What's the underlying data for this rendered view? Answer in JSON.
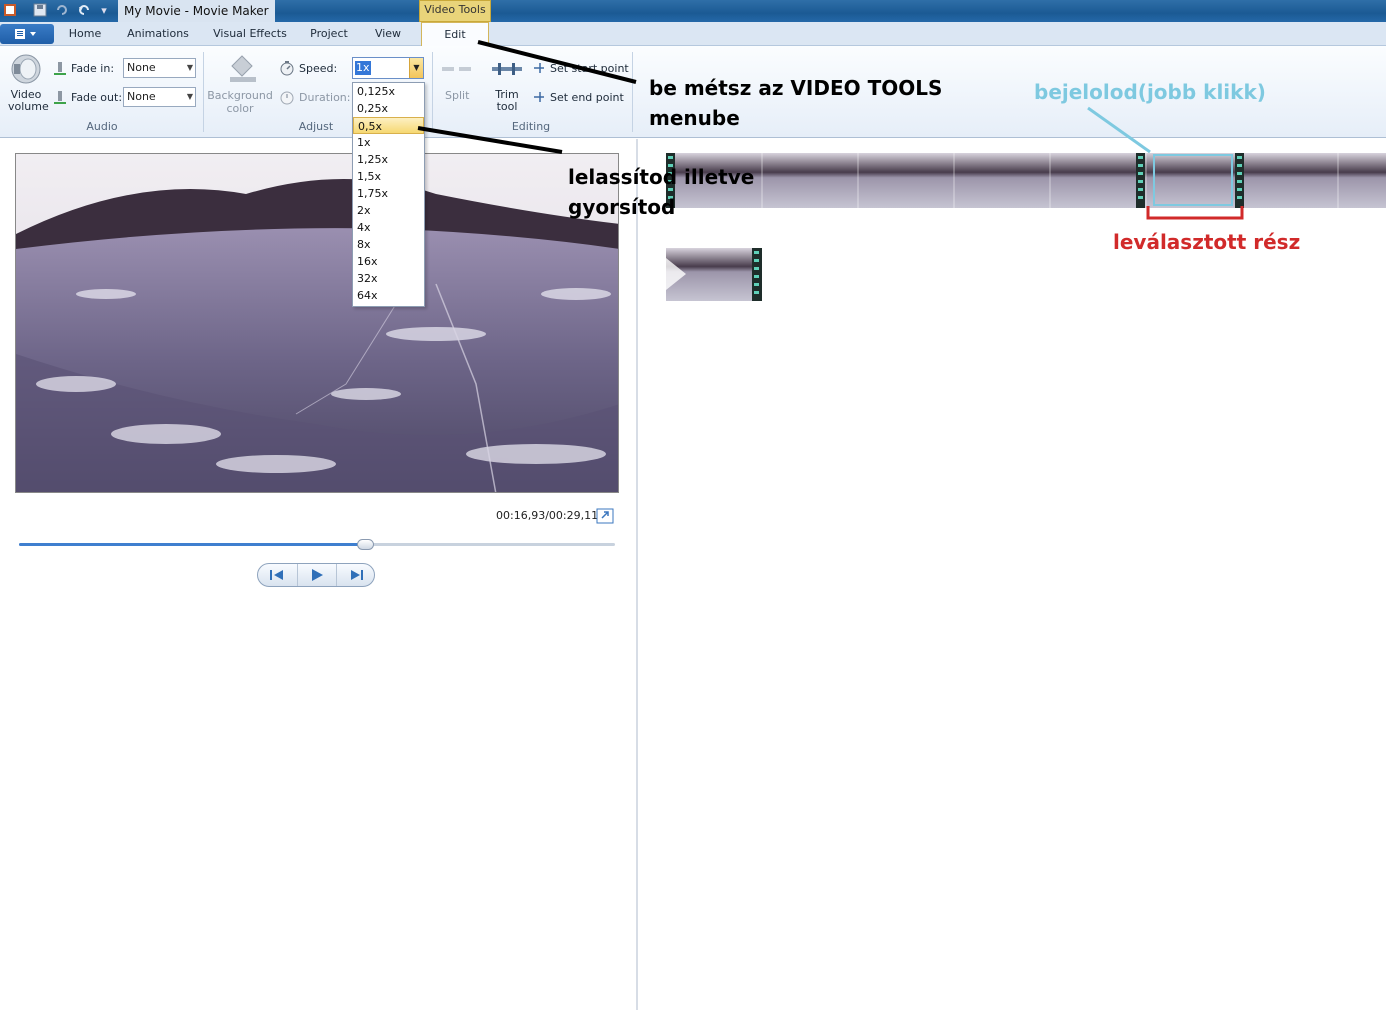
{
  "window": {
    "title": "My Movie - Movie Maker",
    "context_tab": "Video Tools"
  },
  "tabs": [
    {
      "label": "Home"
    },
    {
      "label": "Animations"
    },
    {
      "label": "Visual Effects"
    },
    {
      "label": "Project"
    },
    {
      "label": "View"
    },
    {
      "label": "Edit",
      "active": true
    }
  ],
  "ribbon": {
    "audio": {
      "video_volume": "Video volume",
      "fade_in_label": "Fade in:",
      "fade_in_value": "None",
      "fade_out_label": "Fade out:",
      "fade_out_value": "None",
      "group_label": "Audio"
    },
    "adjust": {
      "background_color": "Background color",
      "speed_label": "Speed:",
      "speed_value": "1x",
      "duration_label": "Duration:",
      "group_label": "Adjust"
    },
    "editing": {
      "split": "Split",
      "trim_tool": "Trim tool",
      "set_start_point": "Set start point",
      "set_end_point": "Set end point",
      "group_label": "Editing"
    }
  },
  "speed_options": [
    "0,125x",
    "0,25x",
    "0,5x",
    "1x",
    "1,25x",
    "1,5x",
    "1,75x",
    "2x",
    "4x",
    "8x",
    "16x",
    "32x",
    "64x"
  ],
  "speed_highlighted": "0,5x",
  "preview": {
    "timecode": "00:16,93/00:29,11",
    "progress": 0.58
  },
  "annotations": {
    "video_tools": "be métsz az VIDEO TOOLS menube",
    "speed": "lelassítod illetve gyorsítod",
    "select": "bejelolod(jobb klikk)",
    "split_part": "leválasztott rész"
  },
  "colors": {
    "annot_select": "#7ec9e0",
    "annot_split": "#d12a2a",
    "context_tab": "#e9d47a"
  }
}
